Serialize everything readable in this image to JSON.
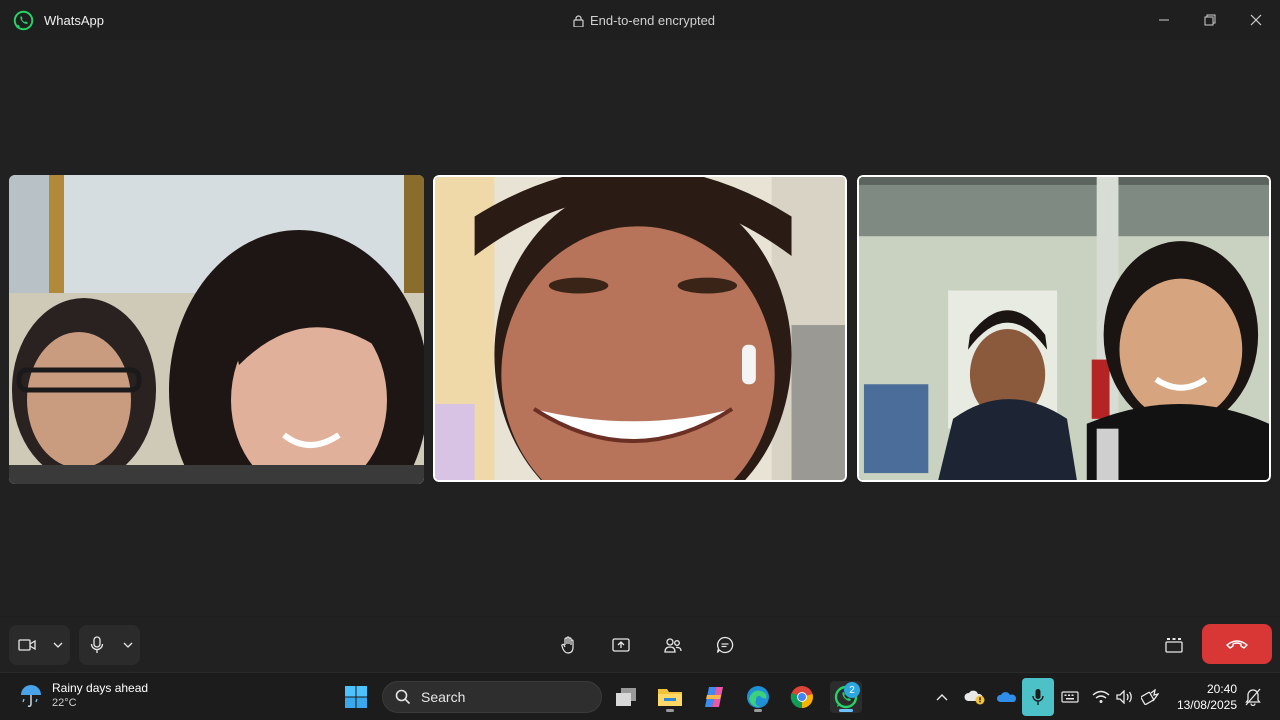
{
  "window": {
    "app_title": "WhatsApp",
    "encryption_text": "End-to-end encrypted",
    "minimize_icon": "minimize-icon",
    "restore_icon": "restore-icon",
    "close_icon": "close-icon"
  },
  "call": {
    "participants": [
      {
        "tile": "left",
        "selected": false
      },
      {
        "tile": "center",
        "selected": true
      },
      {
        "tile": "right",
        "selected": true
      }
    ],
    "controls": {
      "left": [
        "camera-icon",
        "chevron-down-icon",
        "mic-icon",
        "chevron-down-icon"
      ],
      "center": [
        "raise-hand-icon",
        "share-screen-icon",
        "participants-icon",
        "chat-icon"
      ],
      "right": [
        "layout-icon",
        "end-call-icon"
      ],
      "end_call_color": "#d93636"
    }
  },
  "taskbar": {
    "weather": {
      "line1": "Rainy days ahead",
      "line2": "22°C",
      "icon": "rain-umbrella-icon"
    },
    "search_placeholder": "Search",
    "apps": [
      "windows-start-icon",
      "task-view-icon",
      "file-explorer-icon",
      "copilot-icon",
      "edge-icon",
      "chrome-icon",
      "whatsapp-icon"
    ],
    "whatsapp_badge": "2",
    "tray_icons": [
      "chevron-up-icon",
      "onedrive-warning-icon",
      "onedrive-icon",
      "mic-tray-icon",
      "keyboard-icon",
      "wifi-icon",
      "volume-icon",
      "battery-icon",
      "notification-icon"
    ],
    "time": "20:40",
    "date": "13/08/2025",
    "accent": "#4cc2c8"
  }
}
